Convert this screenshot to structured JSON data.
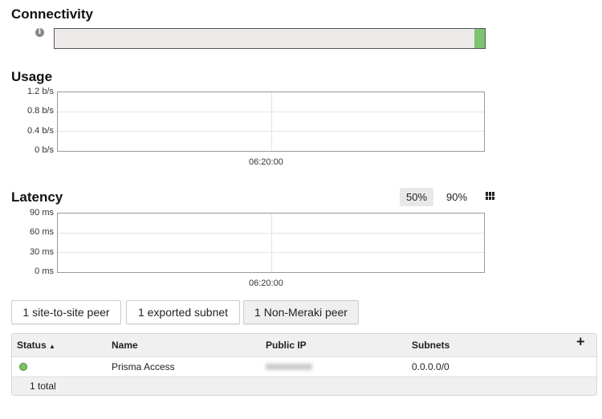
{
  "connectivity": {
    "title": "Connectivity",
    "info_icon": "info-icon",
    "up_fraction": 0.025,
    "up_color": "#7dc470",
    "down_color": "#eeeaea"
  },
  "usage": {
    "title": "Usage",
    "chart_data": {
      "type": "line",
      "y_ticks": [
        "1.2 b/s",
        "0.8 b/s",
        "0.4 b/s",
        "0 b/s"
      ],
      "x_ticks": [
        "06:20:00"
      ],
      "ylim": [
        0,
        1.2
      ],
      "unit": "b/s",
      "series": []
    }
  },
  "latency": {
    "title": "Latency",
    "percentile_buttons": [
      "50%",
      "90%"
    ],
    "selected": "50%",
    "grid_icon": "grid-icon",
    "chart_data": {
      "type": "line",
      "y_ticks": [
        "90 ms",
        "60 ms",
        "30 ms",
        "0 ms"
      ],
      "x_ticks": [
        "06:20:00"
      ],
      "ylim": [
        0,
        90
      ],
      "unit": "ms",
      "series": []
    }
  },
  "tabs": [
    "1 site-to-site peer",
    "1 exported subnet",
    "1 Non-Meraki peer"
  ],
  "active_tab": "1 Non-Meraki peer",
  "table": {
    "columns": [
      "Status",
      "Name",
      "Public IP",
      "Subnets"
    ],
    "sort_indicator": "▲",
    "add_icon": "+",
    "rows": [
      {
        "status": "online",
        "status_color": "#7cc35f",
        "name": "Prisma Access",
        "subnets": "0.0.0.0/0"
      }
    ],
    "footer": "1 total"
  }
}
